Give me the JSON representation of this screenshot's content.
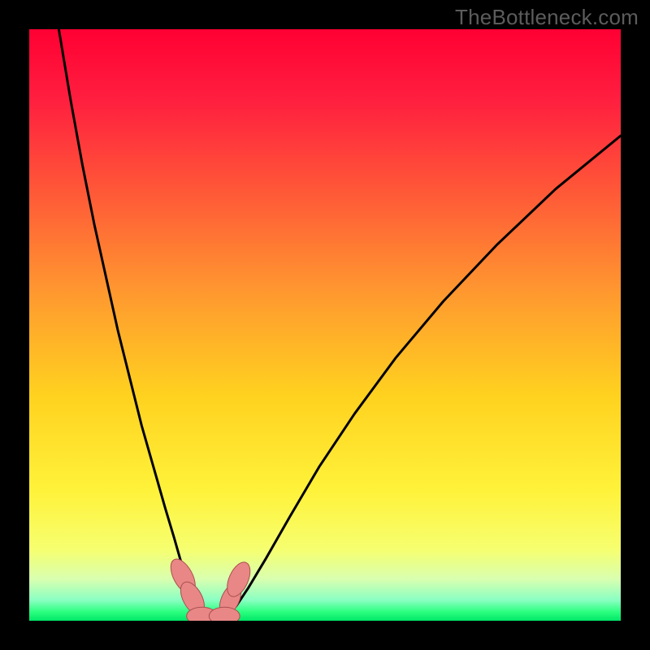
{
  "watermark": "TheBottleneck.com",
  "chart_data": {
    "type": "line",
    "title": "",
    "xlabel": "",
    "ylabel": "",
    "xlim": [
      0,
      100
    ],
    "ylim": [
      0,
      100
    ],
    "gradient_stops": [
      {
        "pos": 0.0,
        "color": "#ff0033"
      },
      {
        "pos": 0.12,
        "color": "#ff1f3f"
      },
      {
        "pos": 0.28,
        "color": "#ff5a37"
      },
      {
        "pos": 0.45,
        "color": "#ff9a2f"
      },
      {
        "pos": 0.62,
        "color": "#ffd21f"
      },
      {
        "pos": 0.78,
        "color": "#fff23a"
      },
      {
        "pos": 0.88,
        "color": "#f6ff70"
      },
      {
        "pos": 0.93,
        "color": "#d8ffb0"
      },
      {
        "pos": 0.965,
        "color": "#8affc2"
      },
      {
        "pos": 0.985,
        "color": "#2cff7f"
      },
      {
        "pos": 1.0,
        "color": "#00e667"
      }
    ],
    "series": [
      {
        "name": "left-curve",
        "x": [
          5,
          7,
          9,
          11,
          13,
          15,
          17,
          19,
          21,
          23,
          24.5,
          25.5,
          26.5,
          27.5,
          28.5,
          30,
          32
        ],
        "y": [
          100,
          88,
          77,
          67,
          58,
          49,
          41,
          33,
          26,
          19,
          14,
          10.5,
          7.2,
          4.5,
          2.5,
          1.0,
          0.2
        ]
      },
      {
        "name": "right-curve",
        "x": [
          32,
          33.5,
          35,
          37,
          40,
          44,
          49,
          55,
          62,
          70,
          79,
          89,
          100
        ],
        "y": [
          0.2,
          1.0,
          2.5,
          5.5,
          10.5,
          17.5,
          26,
          35,
          44.5,
          54,
          63.5,
          73,
          82
        ]
      }
    ],
    "markers": [
      {
        "name": "marker-a",
        "x": 26.0,
        "y": 7.5,
        "rx": 1.6,
        "ry": 3.2,
        "angle": -28
      },
      {
        "name": "marker-b",
        "x": 27.6,
        "y": 3.8,
        "rx": 1.6,
        "ry": 3.0,
        "angle": -28
      },
      {
        "name": "marker-c",
        "x": 34.0,
        "y": 3.6,
        "rx": 1.5,
        "ry": 2.9,
        "angle": 24
      },
      {
        "name": "marker-d",
        "x": 35.4,
        "y": 7.0,
        "rx": 1.6,
        "ry": 3.1,
        "angle": 24
      },
      {
        "name": "marker-e",
        "x": 29.2,
        "y": 0.8,
        "rx": 2.6,
        "ry": 1.5,
        "angle": 0
      },
      {
        "name": "marker-f",
        "x": 33.0,
        "y": 0.8,
        "rx": 2.6,
        "ry": 1.5,
        "angle": 0
      }
    ],
    "marker_fill": "#e98787",
    "marker_stroke": "#aa4e4e"
  }
}
